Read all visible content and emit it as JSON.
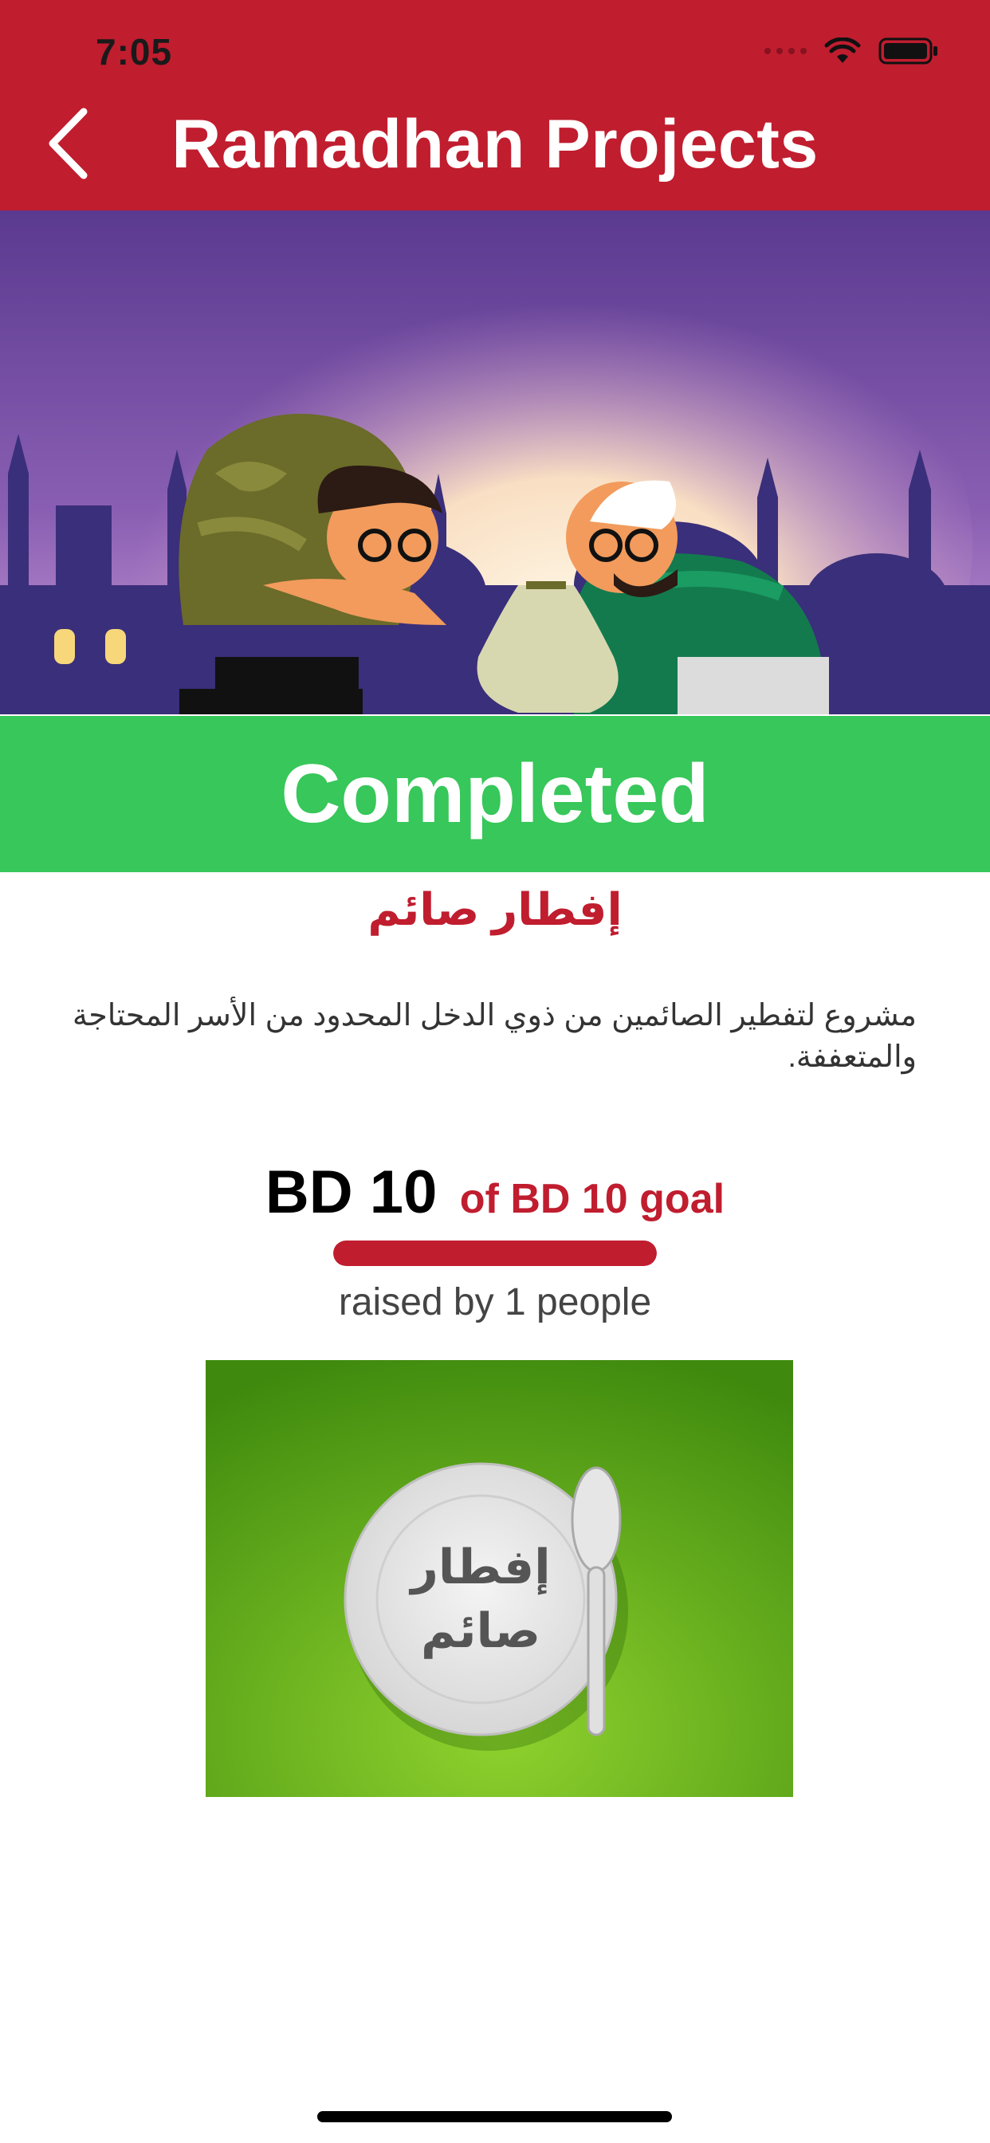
{
  "status_bar": {
    "time": "7:05"
  },
  "header": {
    "title": "Ramadhan Projects",
    "back_icon": "chevron-left-icon"
  },
  "colors": {
    "brand_red": "#c01d2f",
    "completed_green": "#37c75a"
  },
  "banner": {
    "status_label": "Completed"
  },
  "project": {
    "title": "إفطار صائم",
    "description": "مشروع لتفطير الصائمين من ذوي الدخل المحدود من الأسر المحتاجة والمتعففة.",
    "raised": "BD 10",
    "goal": "of BD 10 goal",
    "progress_fraction": 1.0,
    "donors": "raised by 1 people",
    "image_text_line1": "إفطار",
    "image_text_line2": "صائم"
  }
}
